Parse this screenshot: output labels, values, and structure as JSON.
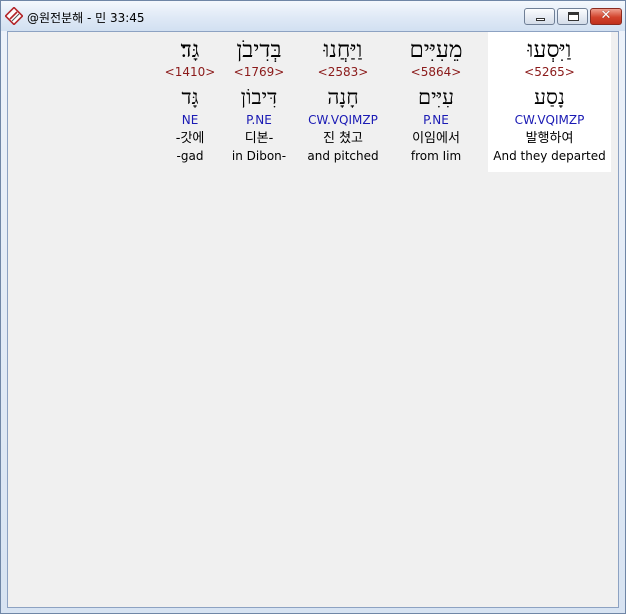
{
  "window": {
    "title": "@원전분해 - 민 33:45"
  },
  "words": [
    {
      "hebrew": "וַיִּסְעוּ",
      "strong": "<5265>",
      "root": "נָסַע",
      "morph": "CW.VQIMZP",
      "korean": "발행하여",
      "english": "And they departed",
      "selected": true
    },
    {
      "hebrew": "מֵעִיִּים",
      "strong": "<5864>",
      "root": "עִיִּים",
      "morph": "P.NE",
      "korean": "이임에서",
      "english": "from Iim",
      "selected": false
    },
    {
      "hebrew": "וַיַּחֲנוּ",
      "strong": "<2583>",
      "root": "חָנָה",
      "morph": "CW.VQIMZP",
      "korean": "진 쳤고",
      "english": "and pitched",
      "selected": false
    },
    {
      "hebrew": "בְּדִיבֹן",
      "strong": "<1769>",
      "root": "דִּיבוֹן",
      "morph": "P.NE",
      "korean": "디본-",
      "english": "in Dibon-",
      "selected": false
    },
    {
      "hebrew": "גָּד׃",
      "strong": "<1410>",
      "root": "גָּד",
      "morph": "NE",
      "korean": "-갓에",
      "english": "-gad",
      "selected": false
    }
  ]
}
